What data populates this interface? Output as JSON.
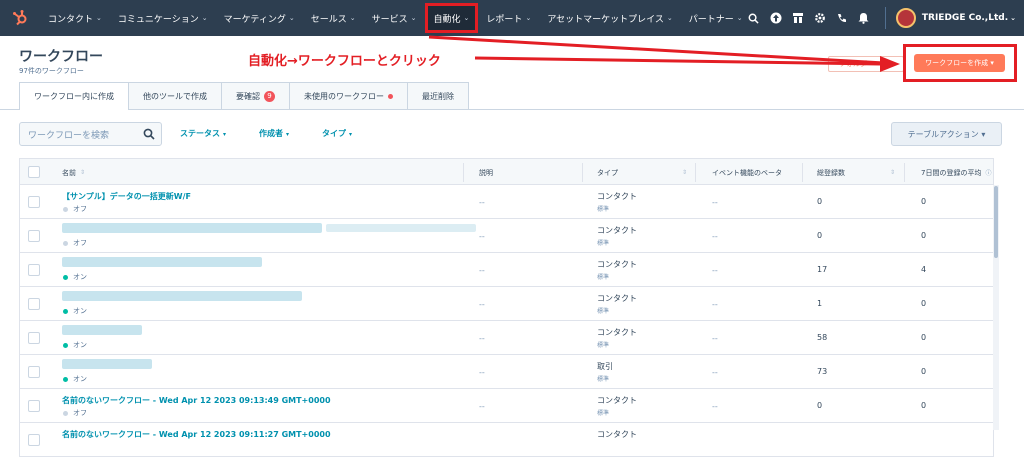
{
  "nav": {
    "items": [
      {
        "label": "コンタクト",
        "name": "nav-contacts"
      },
      {
        "label": "コミュニケーション",
        "name": "nav-conversations"
      },
      {
        "label": "マーケティング",
        "name": "nav-marketing"
      },
      {
        "label": "セールス",
        "name": "nav-sales"
      },
      {
        "label": "サービス",
        "name": "nav-service"
      },
      {
        "label": "自動化",
        "name": "nav-automation"
      },
      {
        "label": "レポート",
        "name": "nav-reports"
      },
      {
        "label": "アセットマーケットプレイス",
        "name": "nav-asset-marketplace"
      },
      {
        "label": "パートナー",
        "name": "nav-partner"
      }
    ],
    "active": "自動化",
    "account_name": "TRIEDGE Co.,Ltd."
  },
  "header": {
    "title": "ワークフロー",
    "subtitle": "97件のワークフロー",
    "annotation": "自動化→ワークフローとクリック",
    "ghost_button": "フォルダー",
    "create_button": "ワークフローを作成 ▾"
  },
  "tabs": [
    {
      "label": "ワークフロー内に作成"
    },
    {
      "label": "他のツールで作成"
    },
    {
      "label": "要確認",
      "badge": "9"
    },
    {
      "label": "未使用のワークフロー",
      "dot": true
    },
    {
      "label": "最近削除"
    }
  ],
  "filters": {
    "search_placeholder": "ワークフローを検索",
    "status": "ステータス",
    "creator": "作成者",
    "type": "タイプ",
    "table_action": "テーブルアクション ▾"
  },
  "table": {
    "columns": [
      "名前",
      "説明",
      "タイプ",
      "イベント機能のベータ",
      "総登録数",
      "7日間の登録の平均"
    ],
    "rows": [
      {
        "name": "【サンプル】データの一括更新W/F",
        "status": "オフ",
        "on": false,
        "description": "--",
        "type": "コンタクト",
        "type_sub": "標準",
        "beta": "--",
        "total": "0",
        "avg": "0"
      },
      {
        "name": "",
        "status": "オフ",
        "on": false,
        "description": "--",
        "type": "コンタクト",
        "type_sub": "標準",
        "beta": "--",
        "total": "0",
        "avg": "0"
      },
      {
        "name": "",
        "status": "オン",
        "on": true,
        "description": "--",
        "type": "コンタクト",
        "type_sub": "標準",
        "beta": "--",
        "total": "17",
        "avg": "4"
      },
      {
        "name": "",
        "status": "オン",
        "on": true,
        "description": "--",
        "type": "コンタクト",
        "type_sub": "標準",
        "beta": "--",
        "total": "1",
        "avg": "0"
      },
      {
        "name": "",
        "status": "オン",
        "on": true,
        "description": "--",
        "type": "コンタクト",
        "type_sub": "標準",
        "beta": "--",
        "total": "58",
        "avg": "0"
      },
      {
        "name": "",
        "status": "オン",
        "on": true,
        "description": "--",
        "type": "取引",
        "type_sub": "標準",
        "beta": "--",
        "total": "73",
        "avg": "0"
      },
      {
        "name": "名前のないワークフロー - Wed Apr 12 2023 09:13:49 GMT+0000",
        "status": "オフ",
        "on": false,
        "description": "--",
        "type": "コンタクト",
        "type_sub": "標準",
        "beta": "--",
        "total": "0",
        "avg": "0"
      },
      {
        "name": "名前のないワークフロー - Wed Apr 12 2023 09:11:27 GMT+0000",
        "status": "",
        "on": false,
        "description": "",
        "type": "コンタクト",
        "type_sub": "",
        "beta": "",
        "total": "",
        "avg": ""
      }
    ]
  },
  "colors": {
    "nav_bg": "#2d3e50",
    "accent": "#ff7a59",
    "link": "#0091ae",
    "annotation": "#e31e24",
    "on": "#00bda5",
    "off": "#cbd6e2"
  }
}
